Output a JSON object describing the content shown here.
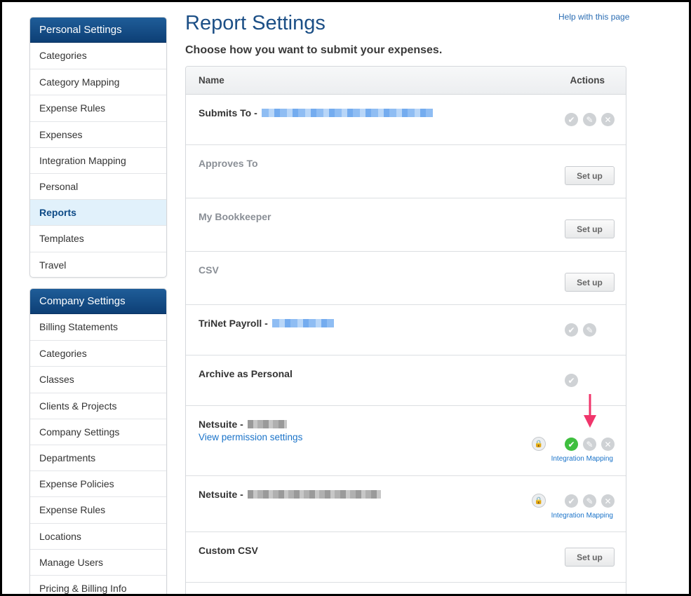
{
  "sidebar": {
    "personal": {
      "title": "Personal Settings",
      "items": [
        "Categories",
        "Category Mapping",
        "Expense Rules",
        "Expenses",
        "Integration Mapping",
        "Personal",
        "Reports",
        "Templates",
        "Travel"
      ],
      "active": "Reports"
    },
    "company": {
      "title": "Company Settings",
      "items": [
        "Billing Statements",
        "Categories",
        "Classes",
        "Clients & Projects",
        "Company Settings",
        "Departments",
        "Expense Policies",
        "Expense Rules",
        "Locations",
        "Manage Users",
        "Pricing & Billing Info"
      ]
    }
  },
  "header": {
    "title": "Report Settings",
    "help_link": "Help with this page",
    "subtitle": "Choose how you want to submit your expenses."
  },
  "table": {
    "col_name": "Name",
    "col_actions": "Actions",
    "rows": [
      {
        "name": "Submits To -"
      },
      {
        "name": "Approves To",
        "button": "Set up"
      },
      {
        "name": "My Bookkeeper",
        "button": "Set up"
      },
      {
        "name": "CSV",
        "button": "Set up"
      },
      {
        "name": "TriNet Payroll -"
      },
      {
        "name": "Archive as Personal"
      },
      {
        "name": "Netsuite -",
        "link": "View permission settings",
        "mapping_link": "Integration Mapping"
      },
      {
        "name": "Netsuite -",
        "mapping_link": "Integration Mapping"
      },
      {
        "name": "Custom CSV",
        "button": "Set up"
      }
    ]
  },
  "icons": {
    "check": "✔",
    "edit": "✎",
    "remove": "✕",
    "lock": "🔒"
  },
  "colors": {
    "header_blue": "#0d3f75",
    "link_blue": "#1a73c9",
    "active_green": "#3fbf3f",
    "arrow_pink": "#f0356b"
  }
}
